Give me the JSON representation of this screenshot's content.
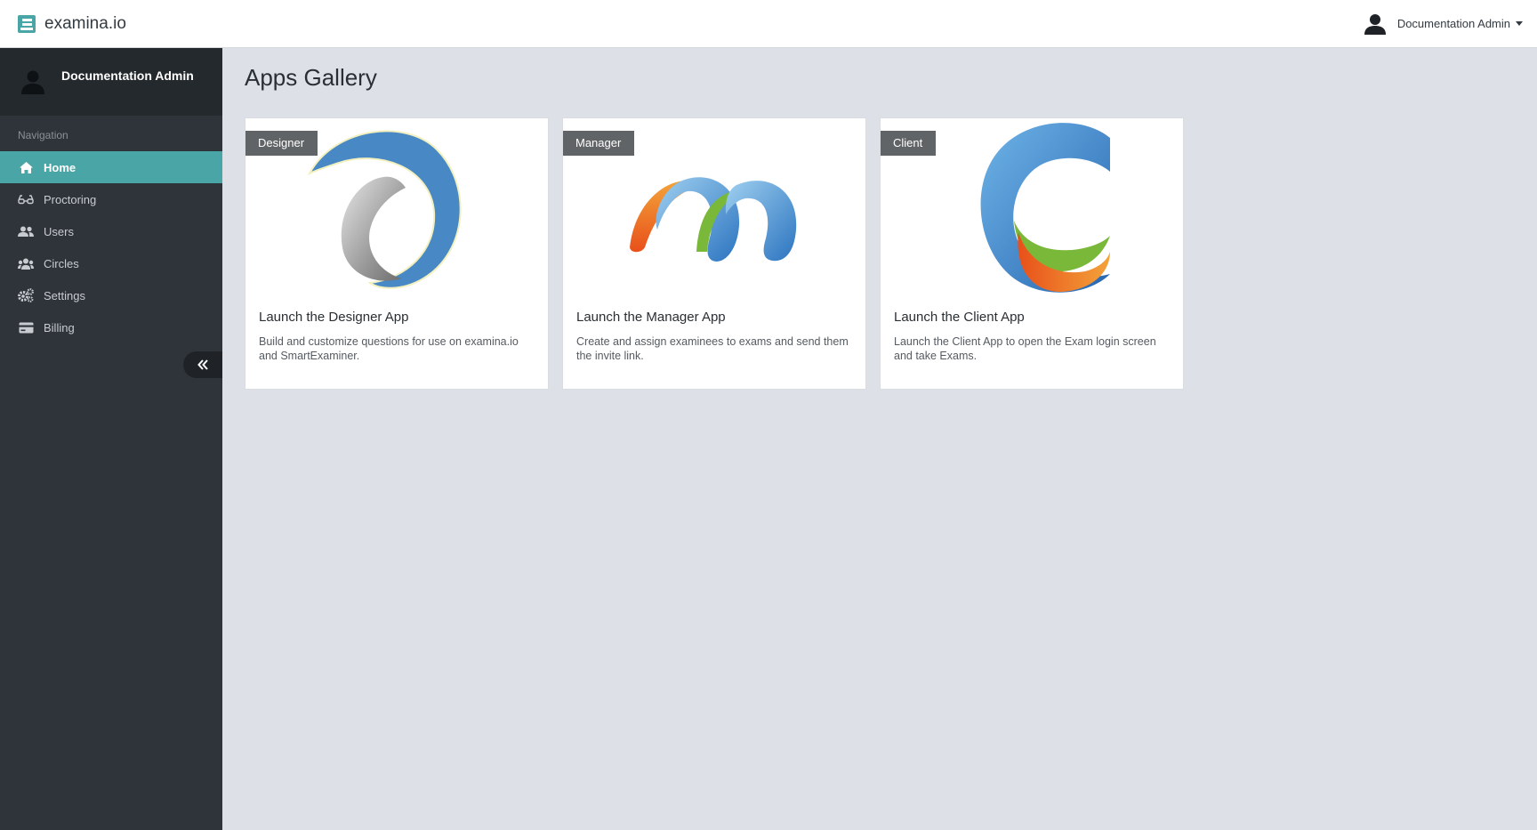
{
  "header": {
    "brand": "examina.io",
    "user_name": "Documentation Admin"
  },
  "sidebar": {
    "profile_name": "Documentation Admin",
    "nav_heading": "Navigation",
    "items": [
      {
        "label": "Home",
        "icon": "home-icon"
      },
      {
        "label": "Proctoring",
        "icon": "glasses-icon"
      },
      {
        "label": "Users",
        "icon": "users-icon"
      },
      {
        "label": "Circles",
        "icon": "circles-icon"
      },
      {
        "label": "Settings",
        "icon": "gears-icon"
      },
      {
        "label": "Billing",
        "icon": "credit-card-icon"
      }
    ],
    "active_item": "Home"
  },
  "main": {
    "title": "Apps Gallery",
    "cards": [
      {
        "tag": "Designer",
        "title": "Launch the Designer App",
        "description": "Build and customize questions for use on examina.io and SmartExaminer."
      },
      {
        "tag": "Manager",
        "title": "Launch the Manager App",
        "description": "Create and assign examinees to exams and send them the invite link."
      },
      {
        "tag": "Client",
        "title": "Launch the Client App",
        "description": "Launch the Client App to open the Exam login screen and take Exams."
      }
    ]
  },
  "colors": {
    "accent": "#4aa5a6",
    "sidebar_bg": "#2f343a",
    "page_bg": "#dde1e7"
  }
}
